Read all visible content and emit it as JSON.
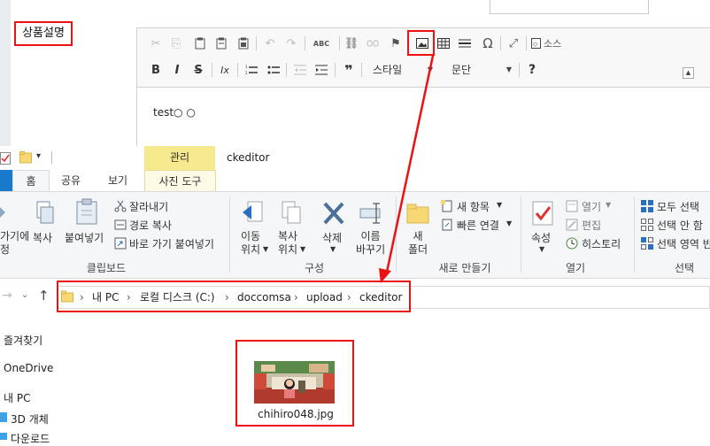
{
  "web": {
    "product_label": "상품설명",
    "editor_text": "test○ ○",
    "toolbar_row1": {
      "cut_icon": "✂",
      "copy_icon": "⎘",
      "paste_icon": "📋",
      "undo_icon": "↶",
      "redo_icon": "↷",
      "spell_icon": "ABC",
      "link_icon": "⛓",
      "flag_icon": "⚑",
      "omega": "Ω",
      "maximize_icon": "⤢",
      "source_label": "소스"
    },
    "toolbar_row2": {
      "bold": "B",
      "italic": "I",
      "strike": "S",
      "clear": "Ix",
      "quote": "❞",
      "help": "?",
      "style_label": "스타일",
      "format_label": "문단"
    }
  },
  "explorer": {
    "window_title": "ckeditor",
    "contextual_tab_group": "관리",
    "tabs": [
      "홈",
      "공유",
      "보기",
      "사진 도구"
    ],
    "ribbon": {
      "clipboard": {
        "pin_label": "가기에\n정",
        "copy_label": "복사",
        "paste_label": "붙여넣기",
        "cut_label": "잘라내기",
        "copy_path_label": "경로 복사",
        "paste_shortcut_label": "바로 가기 붙여넣기",
        "group_label": "클립보드"
      },
      "organize": {
        "move_label": "이동\n위치",
        "copy_to_label": "복사\n위치",
        "delete_label": "삭제",
        "rename_label": "이름\n바꾸기",
        "group_label": "구성"
      },
      "new": {
        "new_folder_label": "새\n폴더",
        "new_item_label": "새 항목",
        "easy_access_label": "빠른 연결",
        "group_label": "새로 만들기"
      },
      "open": {
        "properties_label": "속성",
        "open_label": "열기",
        "edit_label": "편집",
        "history_label": "히스토리",
        "group_label": "열기"
      },
      "select": {
        "select_all_label": "모두 선택",
        "select_none_label": "선택 안 함",
        "invert_label": "선택 영역 반",
        "group_label": "선택"
      }
    },
    "address": [
      "내 PC",
      "로컬 디스크 (C:)",
      "doccomsa",
      "upload",
      "ckeditor"
    ],
    "nav": [
      "즐겨찾기",
      "OneDrive",
      "내 PC",
      "3D 개체",
      "다운로드"
    ],
    "file": {
      "name": "chihiro048.jpg"
    }
  },
  "colors": {
    "highlight": "#e11111",
    "manage_tab": "#f7e98e",
    "file_tab": "#1979ca"
  }
}
